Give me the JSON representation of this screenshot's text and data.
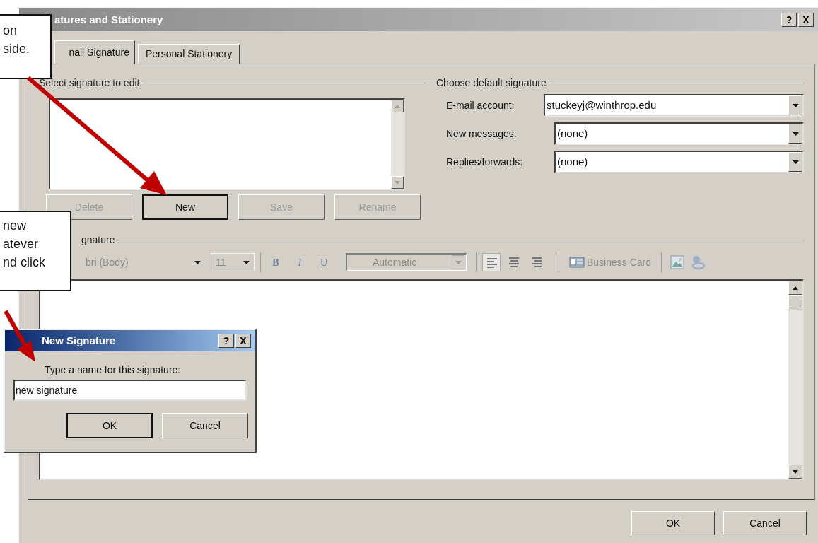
{
  "window": {
    "title": "atures and Stationery",
    "title_buttons": [
      "?",
      "X"
    ]
  },
  "tabs": [
    {
      "label": "nail Signature",
      "selected": true
    },
    {
      "label": "Personal Stationery",
      "selected": false
    }
  ],
  "select_signature": {
    "heading": "Select signature to edit",
    "buttons": [
      {
        "label": "Delete",
        "disabled": true,
        "focused": false
      },
      {
        "label": "New",
        "disabled": false,
        "focused": true
      },
      {
        "label": "Save",
        "disabled": true,
        "focused": false
      },
      {
        "label": "Rename",
        "disabled": true,
        "focused": false
      }
    ]
  },
  "default_signature": {
    "heading": "Choose default signature",
    "fields": [
      {
        "label": "E-mail account:",
        "value": "stuckeyj@winthrop.edu"
      },
      {
        "label": "New messages:",
        "value": "(none)"
      },
      {
        "label": "Replies/forwards:",
        "value": "(none)"
      }
    ]
  },
  "edit_signature": {
    "heading": "gnature",
    "font": "bri (Body)",
    "size": "11",
    "bold": "B",
    "italic": "I",
    "underline": "U",
    "font_color": "Automatic",
    "business_card": "Business Card"
  },
  "footer_buttons": [
    "OK",
    "Cancel"
  ],
  "new_signature_dialog": {
    "title": "New Signature",
    "title_buttons": [
      "?",
      "X"
    ],
    "prompt": "Type a name for this signature:",
    "value": "new signature",
    "buttons": [
      "OK",
      "Cancel"
    ]
  },
  "callouts": [
    {
      "lines": [
        "on",
        "side."
      ]
    },
    {
      "lines": [
        "new",
        "atever",
        "nd click"
      ]
    }
  ]
}
